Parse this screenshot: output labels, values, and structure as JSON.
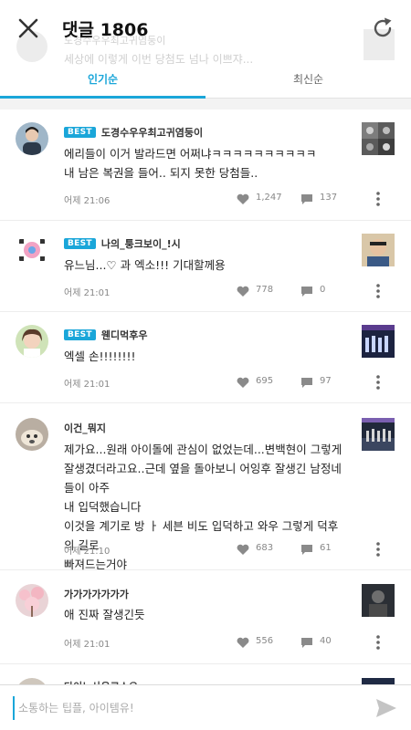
{
  "header": {
    "title": "댓글 1806",
    "ghost_name": "도경수우우최고귀염둥이",
    "ghost_text": "세상에 이렇게 이번 당첨도 넘나 이쁘쟈..."
  },
  "tabs": [
    {
      "label": "인기순",
      "active": true
    },
    {
      "label": "최신순",
      "active": false
    }
  ],
  "comments": [
    {
      "best": true,
      "best_label": "BEST",
      "author": "도경수우우최고귀염둥이",
      "lines": [
        "에리들이 이거 발라드면 어쩌냐ㅋㅋㅋㅋㅋㅋㅋㅋㅋㅋ",
        "내 남은 복권을 들어.. 되지 못한 당첨들.."
      ],
      "time": "어제 21:06",
      "likes": "1,247",
      "replies": "137"
    },
    {
      "best": true,
      "best_label": "BEST",
      "author": "나의_퉁크보이_!시",
      "lines": [
        "유느님...♡ 과 엑소!!! 기대할께용"
      ],
      "time": "어제 21:01",
      "likes": "778",
      "replies": "0"
    },
    {
      "best": true,
      "best_label": "BEST",
      "author": "웬디먹후우",
      "lines": [
        "엑셀 손!!!!!!!!"
      ],
      "time": "어제 21:01",
      "likes": "695",
      "replies": "97"
    },
    {
      "best": false,
      "best_label": "",
      "author": "이건_뭐지",
      "lines": [
        "제가요...원래 아이돌에 관심이 없었는데...변백현이 그렇게",
        "잘생겼더라고요..근데 옆을 돌아보니 어잉후 잘생긴 남정네들이 아주",
        "내 입덕했습니다",
        "이것을 계기로 방   ㅏ 세븐    비도 입덕하고 와우 그렇게 덕후의 길로",
        "빠져드는거야"
      ],
      "time": "어제 21:10",
      "likes": "683",
      "replies": "61"
    },
    {
      "best": false,
      "best_label": "",
      "author": "가가가가가가가",
      "lines": [
        "애 진짜 잘생긴듯"
      ],
      "time": "어제 21:01",
      "likes": "556",
      "replies": "40"
    }
  ],
  "peek": {
    "author": "다이노사우르스오"
  },
  "input": {
    "placeholder": "소통하는 팁플, 아이템유!"
  },
  "colors": {
    "accent": "#1aa6d9",
    "best_badge": "#1aa6d9"
  }
}
